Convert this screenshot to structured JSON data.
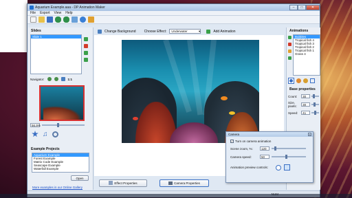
{
  "window": {
    "title": "Aquarium Example.aaa - DP Animation Maker"
  },
  "menu": [
    "File",
    "Export",
    "View",
    "Help"
  ],
  "topbar": {
    "change_background": "Change Background",
    "choose_effect_label": "Choose Effect:",
    "effect_value": "Underwater",
    "add_animation": "Add Animation"
  },
  "slides": {
    "title": "Slides",
    "items": [
      "Slide 1"
    ],
    "navigator_label": "Navigator:",
    "zoom_label": "1:1",
    "zoom_percent": "56.9%"
  },
  "examples": {
    "title": "Example Projects",
    "items": [
      "Aquarium Example",
      "Forest Example",
      "Matrix Code Example",
      "Seascape Example",
      "Waterfall Example"
    ],
    "open_button": "Open",
    "gallery_link": "More examples in our Online Gallery"
  },
  "bottom": {
    "effect_properties": "Effect Properties",
    "camera_properties": "Camera Properties"
  },
  "animations": {
    "title": "Animations",
    "items": [
      "Bubbles",
      "Tropical fish 4",
      "Tropical fish 3",
      "Tropical fish 2",
      "Tropical fish 1",
      "Grass 4"
    ]
  },
  "base_properties": {
    "title": "Base properties",
    "count_label": "Count:",
    "count_value": "30",
    "size_label": "Size, pixels:",
    "size_value": "30",
    "speed_label": "Speed:",
    "speed_value": "41"
  },
  "camera": {
    "title": "Camera",
    "turn_on_label": "Turn on camera animation",
    "turn_on_checked": true,
    "zoom_label": "Scene zoom, %:",
    "zoom_value": "120",
    "speed_label": "Camera speed:",
    "speed_value": "50",
    "preview_label": "Animation preview controls:"
  },
  "status": {
    "num": "NUM"
  }
}
